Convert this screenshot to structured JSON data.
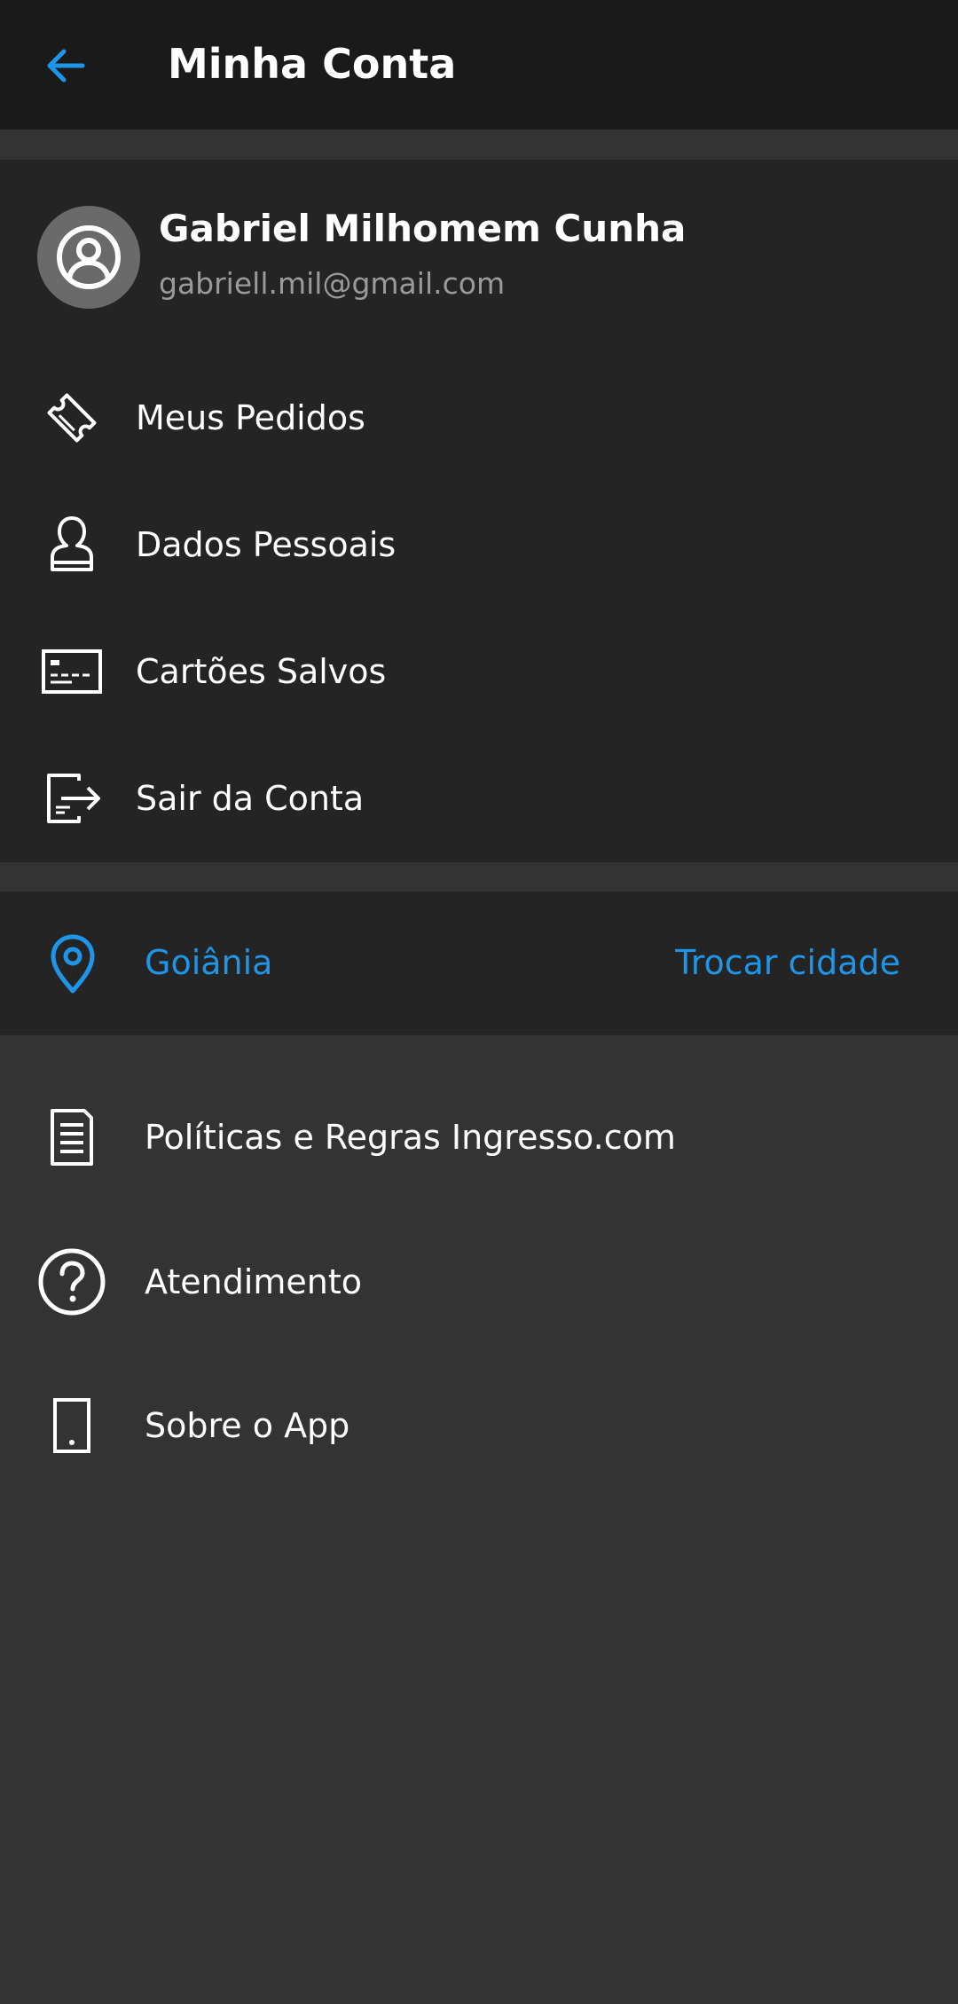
{
  "header": {
    "title": "Minha Conta",
    "back_icon": "arrow-left-icon",
    "accent_color": "#1f95e8"
  },
  "account": {
    "name": "Gabriel Milhomem Cunha",
    "email": "gabriell.mil@gmail.com",
    "avatar_icon": "user-circle-icon",
    "menu": [
      {
        "label": "Meus Pedidos",
        "icon": "ticket-icon"
      },
      {
        "label": "Dados Pessoais",
        "icon": "person-icon"
      },
      {
        "label": "Cartões Salvos",
        "icon": "card-icon"
      },
      {
        "label": "Sair da Conta",
        "icon": "logout-icon"
      }
    ]
  },
  "city": {
    "name": "Goiânia",
    "change_label": "Trocar cidade",
    "icon": "location-pin-icon"
  },
  "info": {
    "items": [
      {
        "label": "Políticas e Regras Ingresso.com",
        "icon": "document-icon"
      },
      {
        "label": "Atendimento",
        "icon": "help-circle-icon"
      },
      {
        "label": "Sobre o App",
        "icon": "phone-icon"
      }
    ]
  }
}
